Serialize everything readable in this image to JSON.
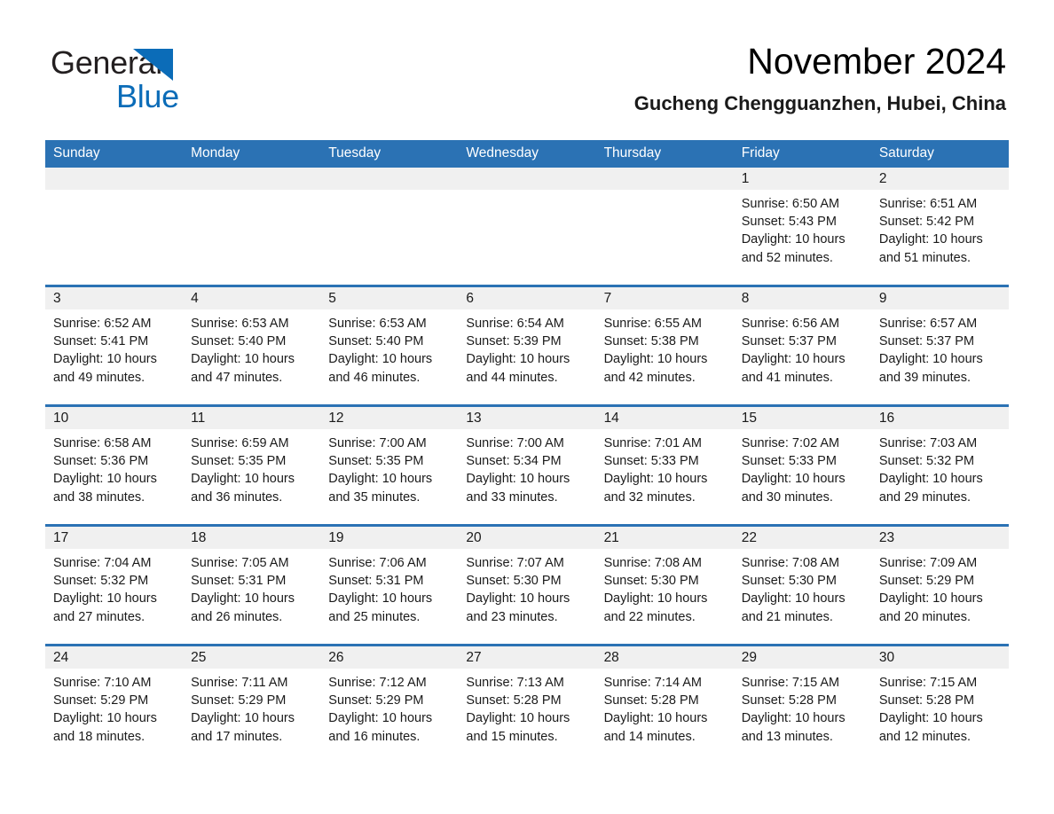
{
  "brand": {
    "name_part1": "General",
    "name_part2": "Blue",
    "triangle_icon": "triangle-icon",
    "accent_color": "#0b6cb8"
  },
  "header": {
    "title": "November 2024",
    "subtitle": "Gucheng Chengguanzhen, Hubei, China"
  },
  "colors": {
    "header_blue": "#2b72b4",
    "date_band_gray": "#f0f0f0",
    "text": "#1a1a1a"
  },
  "weekdays": [
    "Sunday",
    "Monday",
    "Tuesday",
    "Wednesday",
    "Thursday",
    "Friday",
    "Saturday"
  ],
  "weeks": [
    [
      {
        "date": "",
        "empty": true,
        "sunrise": "",
        "sunset": "",
        "daylight_line1": "",
        "daylight_line2": ""
      },
      {
        "date": "",
        "empty": true,
        "sunrise": "",
        "sunset": "",
        "daylight_line1": "",
        "daylight_line2": ""
      },
      {
        "date": "",
        "empty": true,
        "sunrise": "",
        "sunset": "",
        "daylight_line1": "",
        "daylight_line2": ""
      },
      {
        "date": "",
        "empty": true,
        "sunrise": "",
        "sunset": "",
        "daylight_line1": "",
        "daylight_line2": ""
      },
      {
        "date": "",
        "empty": true,
        "sunrise": "",
        "sunset": "",
        "daylight_line1": "",
        "daylight_line2": ""
      },
      {
        "date": "1",
        "empty": false,
        "sunrise": "Sunrise: 6:50 AM",
        "sunset": "Sunset: 5:43 PM",
        "daylight_line1": "Daylight: 10 hours",
        "daylight_line2": "and 52 minutes."
      },
      {
        "date": "2",
        "empty": false,
        "sunrise": "Sunrise: 6:51 AM",
        "sunset": "Sunset: 5:42 PM",
        "daylight_line1": "Daylight: 10 hours",
        "daylight_line2": "and 51 minutes."
      }
    ],
    [
      {
        "date": "3",
        "empty": false,
        "sunrise": "Sunrise: 6:52 AM",
        "sunset": "Sunset: 5:41 PM",
        "daylight_line1": "Daylight: 10 hours",
        "daylight_line2": "and 49 minutes."
      },
      {
        "date": "4",
        "empty": false,
        "sunrise": "Sunrise: 6:53 AM",
        "sunset": "Sunset: 5:40 PM",
        "daylight_line1": "Daylight: 10 hours",
        "daylight_line2": "and 47 minutes."
      },
      {
        "date": "5",
        "empty": false,
        "sunrise": "Sunrise: 6:53 AM",
        "sunset": "Sunset: 5:40 PM",
        "daylight_line1": "Daylight: 10 hours",
        "daylight_line2": "and 46 minutes."
      },
      {
        "date": "6",
        "empty": false,
        "sunrise": "Sunrise: 6:54 AM",
        "sunset": "Sunset: 5:39 PM",
        "daylight_line1": "Daylight: 10 hours",
        "daylight_line2": "and 44 minutes."
      },
      {
        "date": "7",
        "empty": false,
        "sunrise": "Sunrise: 6:55 AM",
        "sunset": "Sunset: 5:38 PM",
        "daylight_line1": "Daylight: 10 hours",
        "daylight_line2": "and 42 minutes."
      },
      {
        "date": "8",
        "empty": false,
        "sunrise": "Sunrise: 6:56 AM",
        "sunset": "Sunset: 5:37 PM",
        "daylight_line1": "Daylight: 10 hours",
        "daylight_line2": "and 41 minutes."
      },
      {
        "date": "9",
        "empty": false,
        "sunrise": "Sunrise: 6:57 AM",
        "sunset": "Sunset: 5:37 PM",
        "daylight_line1": "Daylight: 10 hours",
        "daylight_line2": "and 39 minutes."
      }
    ],
    [
      {
        "date": "10",
        "empty": false,
        "sunrise": "Sunrise: 6:58 AM",
        "sunset": "Sunset: 5:36 PM",
        "daylight_line1": "Daylight: 10 hours",
        "daylight_line2": "and 38 minutes."
      },
      {
        "date": "11",
        "empty": false,
        "sunrise": "Sunrise: 6:59 AM",
        "sunset": "Sunset: 5:35 PM",
        "daylight_line1": "Daylight: 10 hours",
        "daylight_line2": "and 36 minutes."
      },
      {
        "date": "12",
        "empty": false,
        "sunrise": "Sunrise: 7:00 AM",
        "sunset": "Sunset: 5:35 PM",
        "daylight_line1": "Daylight: 10 hours",
        "daylight_line2": "and 35 minutes."
      },
      {
        "date": "13",
        "empty": false,
        "sunrise": "Sunrise: 7:00 AM",
        "sunset": "Sunset: 5:34 PM",
        "daylight_line1": "Daylight: 10 hours",
        "daylight_line2": "and 33 minutes."
      },
      {
        "date": "14",
        "empty": false,
        "sunrise": "Sunrise: 7:01 AM",
        "sunset": "Sunset: 5:33 PM",
        "daylight_line1": "Daylight: 10 hours",
        "daylight_line2": "and 32 minutes."
      },
      {
        "date": "15",
        "empty": false,
        "sunrise": "Sunrise: 7:02 AM",
        "sunset": "Sunset: 5:33 PM",
        "daylight_line1": "Daylight: 10 hours",
        "daylight_line2": "and 30 minutes."
      },
      {
        "date": "16",
        "empty": false,
        "sunrise": "Sunrise: 7:03 AM",
        "sunset": "Sunset: 5:32 PM",
        "daylight_line1": "Daylight: 10 hours",
        "daylight_line2": "and 29 minutes."
      }
    ],
    [
      {
        "date": "17",
        "empty": false,
        "sunrise": "Sunrise: 7:04 AM",
        "sunset": "Sunset: 5:32 PM",
        "daylight_line1": "Daylight: 10 hours",
        "daylight_line2": "and 27 minutes."
      },
      {
        "date": "18",
        "empty": false,
        "sunrise": "Sunrise: 7:05 AM",
        "sunset": "Sunset: 5:31 PM",
        "daylight_line1": "Daylight: 10 hours",
        "daylight_line2": "and 26 minutes."
      },
      {
        "date": "19",
        "empty": false,
        "sunrise": "Sunrise: 7:06 AM",
        "sunset": "Sunset: 5:31 PM",
        "daylight_line1": "Daylight: 10 hours",
        "daylight_line2": "and 25 minutes."
      },
      {
        "date": "20",
        "empty": false,
        "sunrise": "Sunrise: 7:07 AM",
        "sunset": "Sunset: 5:30 PM",
        "daylight_line1": "Daylight: 10 hours",
        "daylight_line2": "and 23 minutes."
      },
      {
        "date": "21",
        "empty": false,
        "sunrise": "Sunrise: 7:08 AM",
        "sunset": "Sunset: 5:30 PM",
        "daylight_line1": "Daylight: 10 hours",
        "daylight_line2": "and 22 minutes."
      },
      {
        "date": "22",
        "empty": false,
        "sunrise": "Sunrise: 7:08 AM",
        "sunset": "Sunset: 5:30 PM",
        "daylight_line1": "Daylight: 10 hours",
        "daylight_line2": "and 21 minutes."
      },
      {
        "date": "23",
        "empty": false,
        "sunrise": "Sunrise: 7:09 AM",
        "sunset": "Sunset: 5:29 PM",
        "daylight_line1": "Daylight: 10 hours",
        "daylight_line2": "and 20 minutes."
      }
    ],
    [
      {
        "date": "24",
        "empty": false,
        "sunrise": "Sunrise: 7:10 AM",
        "sunset": "Sunset: 5:29 PM",
        "daylight_line1": "Daylight: 10 hours",
        "daylight_line2": "and 18 minutes."
      },
      {
        "date": "25",
        "empty": false,
        "sunrise": "Sunrise: 7:11 AM",
        "sunset": "Sunset: 5:29 PM",
        "daylight_line1": "Daylight: 10 hours",
        "daylight_line2": "and 17 minutes."
      },
      {
        "date": "26",
        "empty": false,
        "sunrise": "Sunrise: 7:12 AM",
        "sunset": "Sunset: 5:29 PM",
        "daylight_line1": "Daylight: 10 hours",
        "daylight_line2": "and 16 minutes."
      },
      {
        "date": "27",
        "empty": false,
        "sunrise": "Sunrise: 7:13 AM",
        "sunset": "Sunset: 5:28 PM",
        "daylight_line1": "Daylight: 10 hours",
        "daylight_line2": "and 15 minutes."
      },
      {
        "date": "28",
        "empty": false,
        "sunrise": "Sunrise: 7:14 AM",
        "sunset": "Sunset: 5:28 PM",
        "daylight_line1": "Daylight: 10 hours",
        "daylight_line2": "and 14 minutes."
      },
      {
        "date": "29",
        "empty": false,
        "sunrise": "Sunrise: 7:15 AM",
        "sunset": "Sunset: 5:28 PM",
        "daylight_line1": "Daylight: 10 hours",
        "daylight_line2": "and 13 minutes."
      },
      {
        "date": "30",
        "empty": false,
        "sunrise": "Sunrise: 7:15 AM",
        "sunset": "Sunset: 5:28 PM",
        "daylight_line1": "Daylight: 10 hours",
        "daylight_line2": "and 12 minutes."
      }
    ]
  ]
}
